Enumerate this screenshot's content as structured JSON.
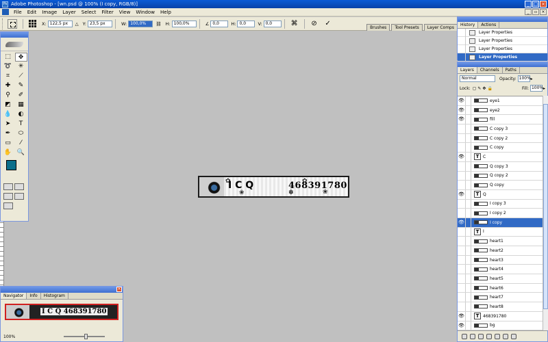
{
  "title": "Adobe Photoshop - [wn.psd @ 100% (I copy, RGB/8)]",
  "menu": [
    "File",
    "Edit",
    "Image",
    "Layer",
    "Select",
    "Filter",
    "View",
    "Window",
    "Help"
  ],
  "options": {
    "x_label": "X:",
    "x_value": "122,5 px",
    "y_label": "Y:",
    "y_value": "23,5 px",
    "w_label": "W:",
    "w_value": "100,0%",
    "h_label": "H:",
    "h_value": "100,0%",
    "angle_value": "0,0",
    "hskew_label": "H:",
    "hskew_value": "0,0",
    "vskew_label": "V:",
    "vskew_value": "0,0",
    "well_tabs": [
      "Brushes",
      "Tool Presets",
      "Layer Comps"
    ]
  },
  "document": {
    "letters": "I C Q",
    "number": "468391780"
  },
  "navigator": {
    "tabs": [
      "Navigator",
      "Info",
      "Histogram"
    ],
    "thumb_text": "I C Q 468391780",
    "zoom": "100%"
  },
  "history": {
    "tabs": [
      "History",
      "Actions"
    ],
    "rows": [
      "Layer Properties",
      "Layer Properties",
      "Layer Properties",
      "Layer Properties"
    ]
  },
  "layers_panel": {
    "tabs": [
      "Layers",
      "Channels",
      "Paths"
    ],
    "blend_mode": "Normal",
    "opacity_label": "Opacity:",
    "opacity": "100%",
    "lock_label": "Lock:",
    "fill_label": "Fill:",
    "fill": "100%",
    "layers": [
      {
        "name": "eye1",
        "visible": true,
        "type": "img"
      },
      {
        "name": "eye2",
        "visible": true,
        "type": "img"
      },
      {
        "name": "fill",
        "visible": true,
        "type": "img"
      },
      {
        "name": "C copy 3",
        "visible": false,
        "type": "img"
      },
      {
        "name": "C copy 2",
        "visible": false,
        "type": "img"
      },
      {
        "name": "C copy",
        "visible": false,
        "type": "img"
      },
      {
        "name": "C",
        "visible": true,
        "type": "text"
      },
      {
        "name": "Q copy 3",
        "visible": false,
        "type": "img"
      },
      {
        "name": "Q copy 2",
        "visible": false,
        "type": "img"
      },
      {
        "name": "Q copy",
        "visible": false,
        "type": "img"
      },
      {
        "name": "Q",
        "visible": true,
        "type": "text"
      },
      {
        "name": "I copy 3",
        "visible": false,
        "type": "img"
      },
      {
        "name": "I copy 2",
        "visible": false,
        "type": "img"
      },
      {
        "name": "I copy",
        "visible": true,
        "type": "img",
        "selected": true
      },
      {
        "name": "I",
        "visible": false,
        "type": "text"
      },
      {
        "name": "heart1",
        "visible": false,
        "type": "img"
      },
      {
        "name": "heart2",
        "visible": false,
        "type": "img"
      },
      {
        "name": "heart3",
        "visible": false,
        "type": "img"
      },
      {
        "name": "heart4",
        "visible": false,
        "type": "img"
      },
      {
        "name": "heart5",
        "visible": false,
        "type": "img"
      },
      {
        "name": "heart6",
        "visible": false,
        "type": "img"
      },
      {
        "name": "heart7",
        "visible": false,
        "type": "img"
      },
      {
        "name": "heart8",
        "visible": false,
        "type": "img"
      },
      {
        "name": "468391780",
        "visible": true,
        "type": "text"
      },
      {
        "name": "bg",
        "visible": true,
        "type": "img"
      }
    ]
  }
}
